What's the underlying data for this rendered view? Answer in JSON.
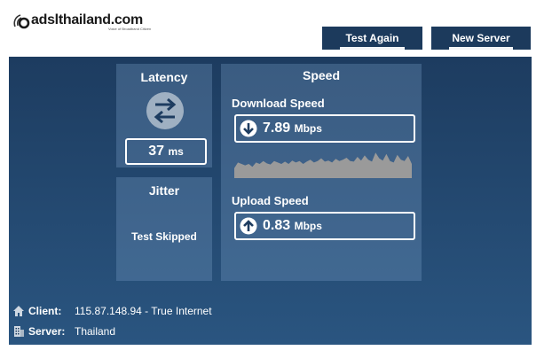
{
  "logo": {
    "text": "adslthailand.com",
    "tagline": "Voice of Broadband Citizen"
  },
  "toolbar": {
    "test_again_label": "Test Again",
    "new_server_label": "New Server"
  },
  "latency": {
    "title": "Latency",
    "value": "37",
    "unit": "ms",
    "icon": "arrows-exchange-icon"
  },
  "jitter": {
    "title": "Jitter",
    "status": "Test Skipped"
  },
  "speed": {
    "title": "Speed",
    "download": {
      "label": "Download Speed",
      "value": "7.89",
      "unit": "Mbps",
      "icon": "download-arrow-icon"
    },
    "upload": {
      "label": "Upload Speed",
      "value": "0.83",
      "unit": "Mbps",
      "icon": "upload-arrow-icon"
    },
    "download_graph_samples": [
      0.35,
      0.55,
      0.5,
      0.45,
      0.5,
      0.4,
      0.55,
      0.5,
      0.6,
      0.52,
      0.48,
      0.6,
      0.55,
      0.5,
      0.58,
      0.5,
      0.62,
      0.55,
      0.6,
      0.5,
      0.58,
      0.65,
      0.55,
      0.6,
      0.7,
      0.58,
      0.62,
      0.55,
      0.68,
      0.6,
      0.65,
      0.72,
      0.6,
      0.58,
      0.75,
      0.62,
      0.8,
      0.65,
      0.58,
      0.9,
      0.7,
      0.62,
      0.85,
      0.6,
      0.55,
      0.82,
      0.65,
      0.6,
      0.78,
      0.5
    ]
  },
  "client": {
    "label": "Client:",
    "value": "115.87.148.94 - True Internet",
    "icon": "home-icon"
  },
  "server": {
    "label": "Server:",
    "value": "Thailand",
    "icon": "building-icon"
  },
  "colors": {
    "panel_top": "#1d3c60",
    "panel_bottom": "#2a5580",
    "button": "#1c3a5c",
    "graph": "#9a9a9a"
  }
}
